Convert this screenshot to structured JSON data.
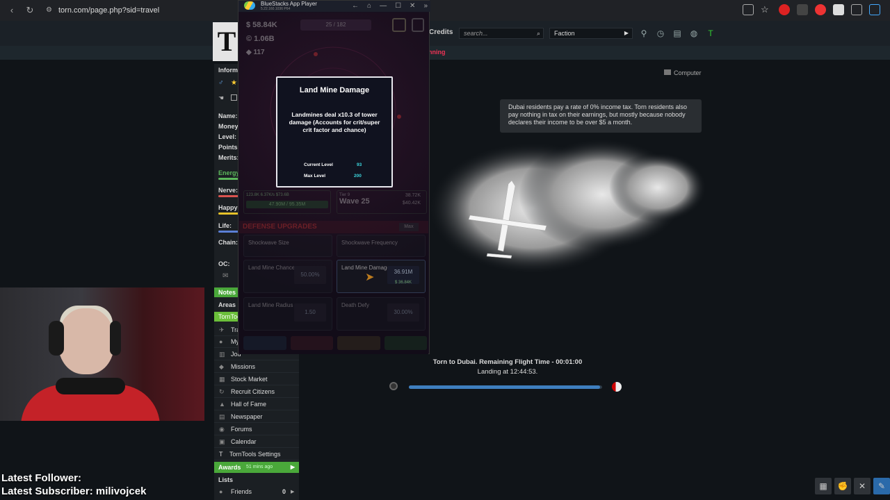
{
  "browser": {
    "url": "torn.com/page.php?sid=travel",
    "back": "‹",
    "reload": "↻"
  },
  "torn_header": {
    "logo": "T",
    "credits": "Credits",
    "search_placeholder": "search...",
    "faction_select": "Faction",
    "running_text": "nning"
  },
  "sidebar": {
    "info_label": "Informa",
    "stats": [
      {
        "label": "Name:"
      },
      {
        "label": "Money:"
      },
      {
        "label": "Level:"
      },
      {
        "label": "Points:"
      },
      {
        "label": "Merits:"
      }
    ],
    "bars": [
      {
        "label": "Energy",
        "color": "#5cb85c"
      },
      {
        "label": "Nerve:",
        "color": "#d9534f"
      },
      {
        "label": "Happy:",
        "color": "#e6c229"
      },
      {
        "label": "Life:",
        "color": "#5b7fd6"
      }
    ],
    "chain_label": "Chain:",
    "oc_label": "OC:",
    "notes": "Notes",
    "areas": "Areas",
    "torntools": "TornToo",
    "partial_links": [
      "Tra",
      "My",
      "Jou"
    ],
    "links": [
      "Missions",
      "Stock Market",
      "Recruit Citizens",
      "Hall of Fame",
      "Newspaper",
      "Forums",
      "Calendar",
      "TornTools Settings"
    ],
    "awards": "Awards",
    "awards_time": "51 mins ago",
    "lists": "Lists",
    "friends": "Friends",
    "friends_count": "0"
  },
  "main": {
    "computer_label": "Computer",
    "tax_notice": "Dubai residents pay a rate of 0% income tax. Torn residents also pay nothing in tax on their earnings, but mostly because nobody declares their income to be over $5 a month.",
    "flight_text": "Torn to Dubai. Remaining Flight Time - 00:01:00",
    "landing_text": "Landing at 12:44:53.",
    "flight_progress": 0.99
  },
  "bluestacks": {
    "title": "BlueStacks App Player",
    "version": "5.22.160.1036 P64",
    "controls": [
      "←",
      "⌂",
      "—",
      "☐",
      "✕",
      "»"
    ]
  },
  "game": {
    "cash": "$ 58.84K",
    "coins": "1.06B",
    "gems": "117",
    "wave_counter": "25 / 182",
    "hud_left": "123.8K  6.37K/s  $73.6B",
    "hud_left2": "47.90M / 95.35M",
    "tier": "Tier 9",
    "wave": "Wave 25",
    "hud_right_stat": "38.72K",
    "hud_right_stat2": "$40.42K",
    "section": "DEFENSE UPGRADES",
    "max_button": "Max",
    "upgrades": [
      {
        "name": "Shockwave Size",
        "value": ""
      },
      {
        "name": "Shockwave Frequency",
        "value": ""
      },
      {
        "name": "Land Mine Chance",
        "value": "50.00%"
      },
      {
        "name": "Land Mine Damage",
        "value": "36.91M",
        "cost": "$ 36.84K"
      },
      {
        "name": "Land Mine Radius",
        "value": "1.50"
      },
      {
        "name": "Death Defy",
        "value": "30.00%"
      }
    ]
  },
  "popup": {
    "title": "Land Mine Damage",
    "description": "Landmines deal x10.3 of tower damage (Accounts for crit/super crit factor and chance)",
    "current_level_label": "Current Level",
    "current_level": "93",
    "max_level_label": "Max Level",
    "max_level": "200"
  },
  "overlay": {
    "follower": "Latest Follower:",
    "subscriber": "Latest Subscriber: milivojcek"
  }
}
